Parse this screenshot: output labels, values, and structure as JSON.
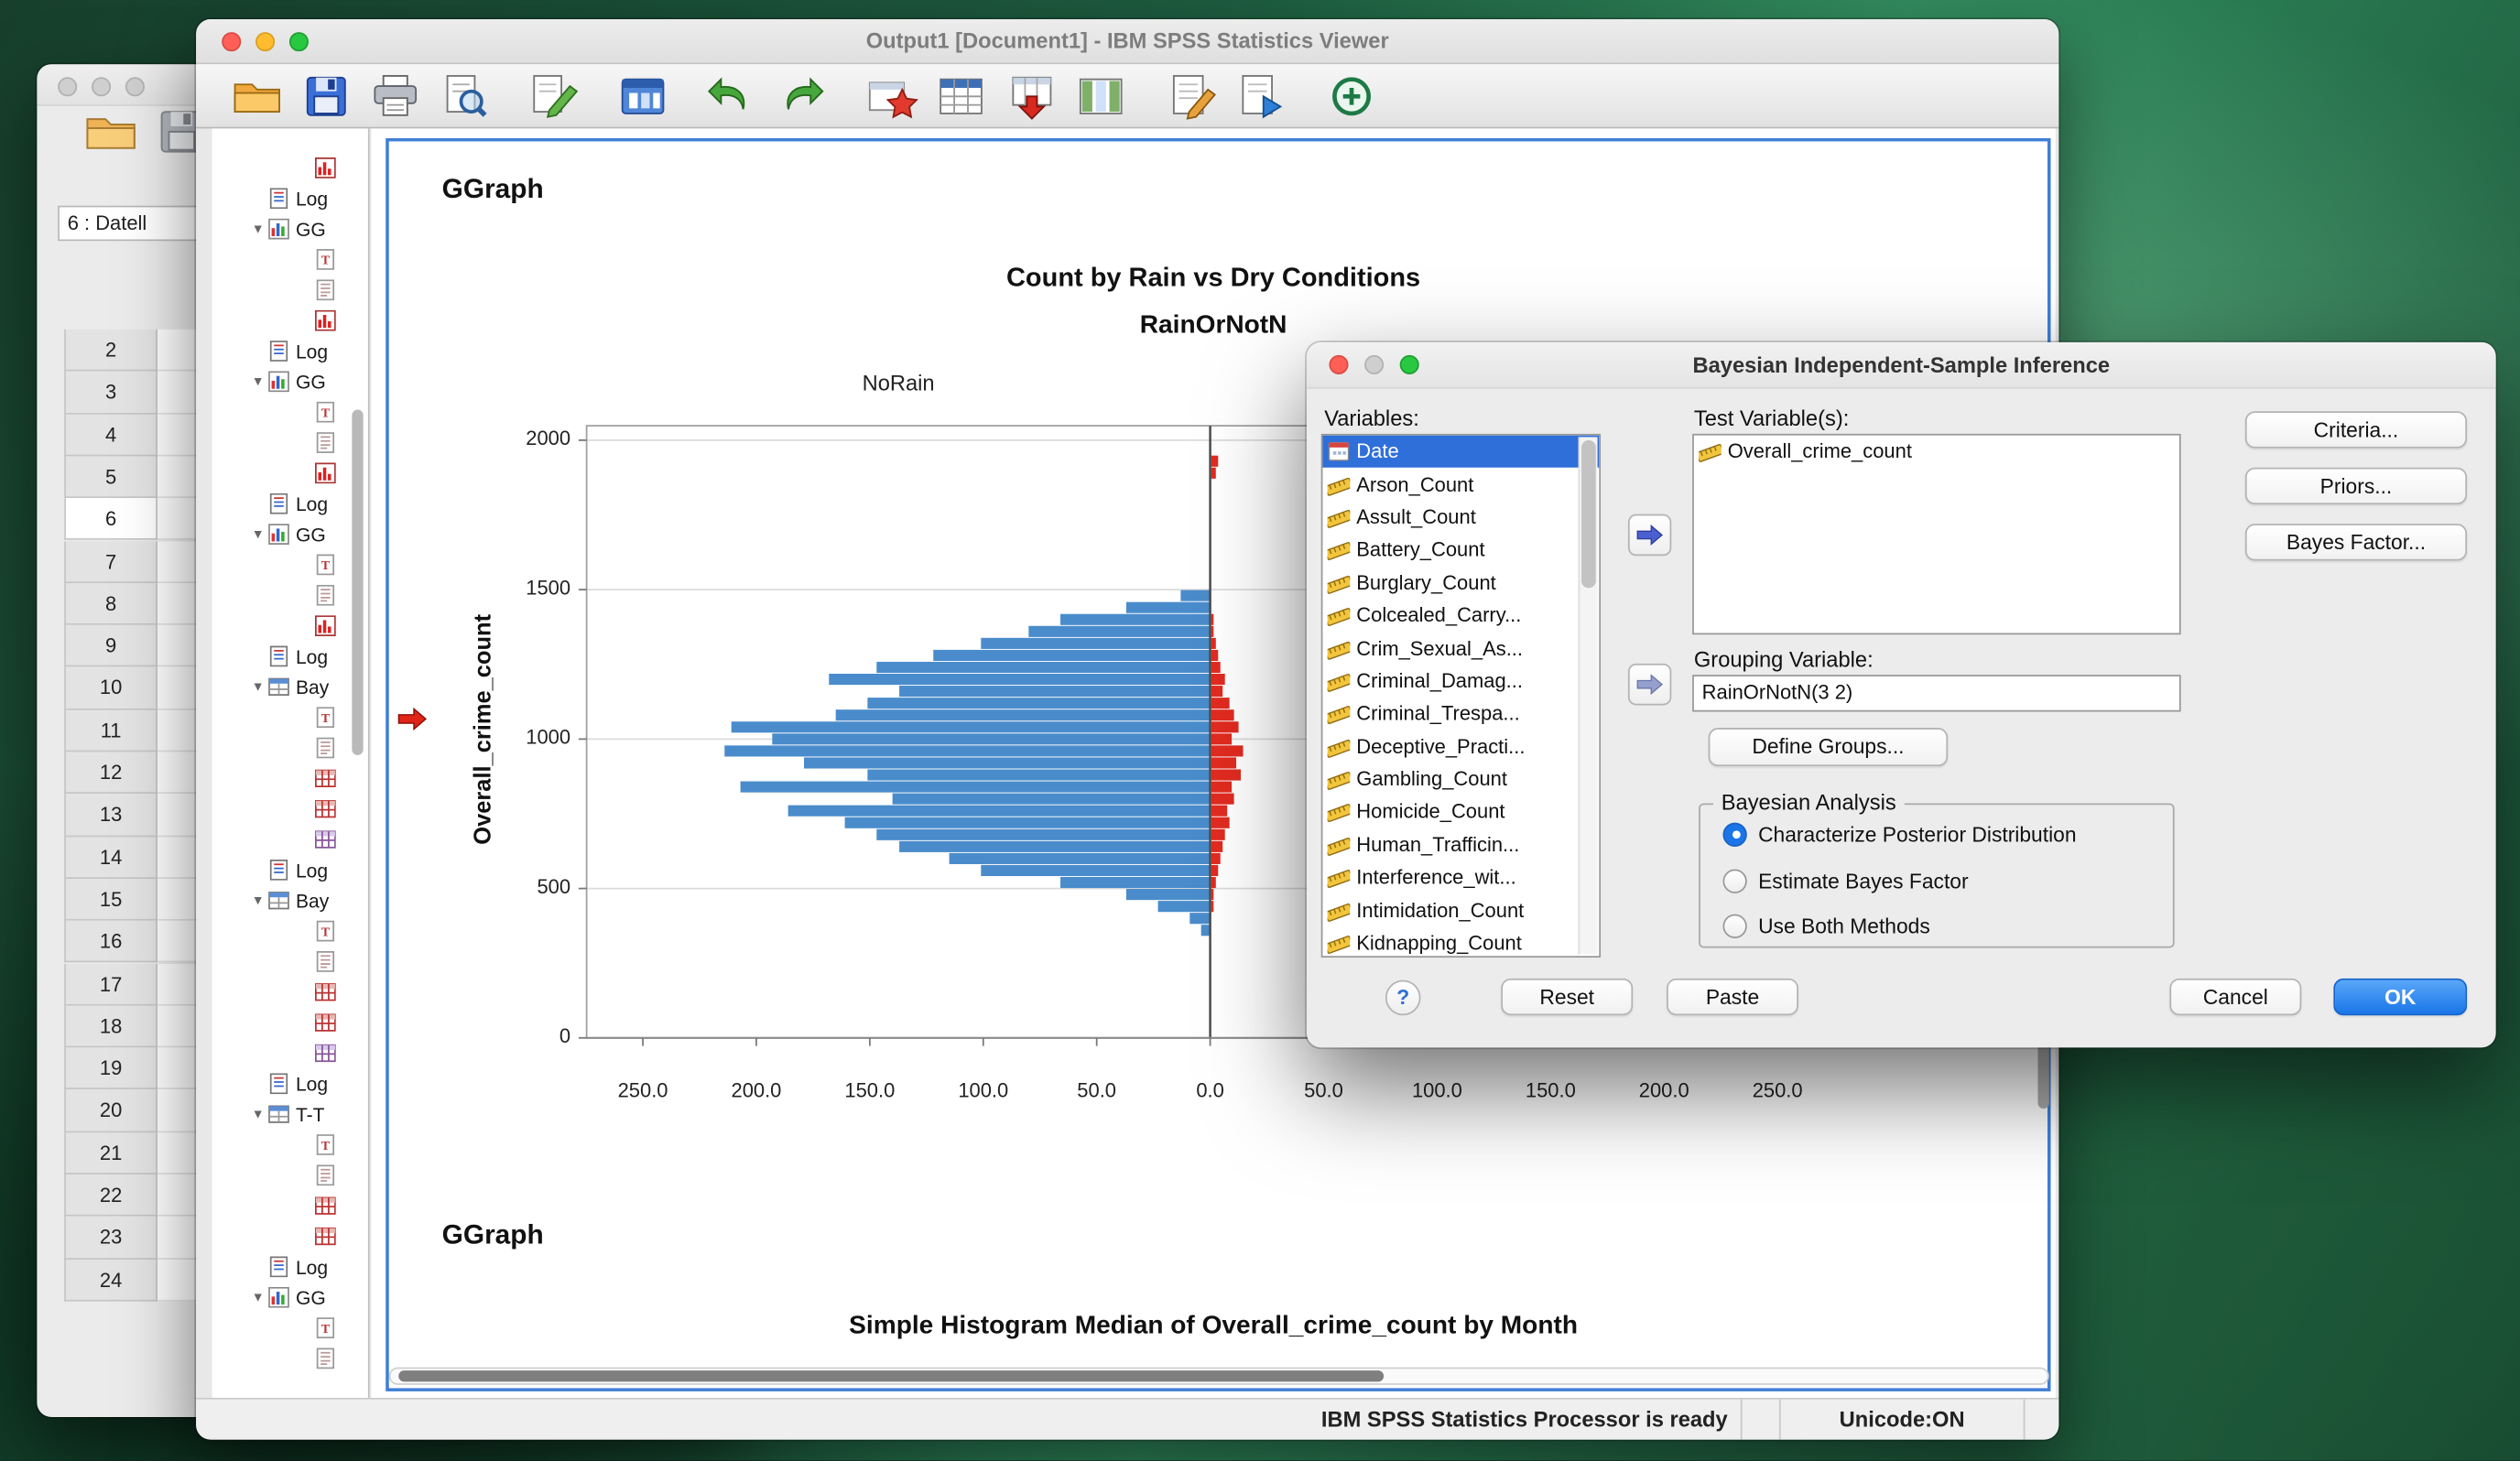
{
  "desktop": {
    "wallpaper_primary": "#2f8a5c"
  },
  "icons": {
    "marker": "red-arrow-icon",
    "transfer_primary": "transfer-arrow-icon",
    "transfer_secondary": "transfer-arrow-secondary-icon"
  },
  "data_editor": {
    "cell_ref": "6 : Datell",
    "row_numbers": [
      "2",
      "3",
      "4",
      "5",
      "6",
      "7",
      "8",
      "9",
      "10",
      "11",
      "12",
      "13",
      "14",
      "15",
      "16",
      "17",
      "18",
      "19",
      "20",
      "21",
      "22",
      "23",
      "24"
    ],
    "selected_row": "6",
    "toolbar_icons": [
      {
        "name": "open-icon"
      },
      {
        "name": "save-gray-icon"
      }
    ]
  },
  "viewer": {
    "title": "Output1 [Document1] - IBM SPSS Statistics Viewer",
    "toolbar_icons": [
      {
        "name": "open-icon"
      },
      {
        "name": "save-icon"
      },
      {
        "name": "print-icon"
      },
      {
        "name": "print-preview-icon"
      },
      {
        "name": "export-icon"
      },
      {
        "name": "recall-dialogs-icon"
      },
      {
        "name": "undo-icon"
      },
      {
        "name": "redo-icon"
      },
      {
        "name": "goto-case-icon"
      },
      {
        "name": "goto-variable-icon"
      },
      {
        "name": "use-variable-sets-icon"
      },
      {
        "name": "show-variables-icon"
      },
      {
        "name": "insert-heading-icon"
      },
      {
        "name": "run-script-icon"
      },
      {
        "name": "designate-window-icon"
      }
    ],
    "outline": [
      {
        "icon": "chart-icon",
        "label": "",
        "depth": 2
      },
      {
        "icon": "log-icon",
        "label": "Log",
        "depth": 1
      },
      {
        "icon": "ggraph-icon",
        "label": "GG",
        "depth": 1,
        "expander": true
      },
      {
        "icon": "title-icon",
        "label": "",
        "depth": 2
      },
      {
        "icon": "notes-icon",
        "label": "",
        "depth": 2
      },
      {
        "icon": "chart-icon",
        "label": "",
        "depth": 2
      },
      {
        "icon": "log-icon",
        "label": "Log",
        "depth": 1
      },
      {
        "icon": "ggraph-icon",
        "label": "GG",
        "depth": 1,
        "expander": true
      },
      {
        "icon": "title-icon",
        "label": "",
        "depth": 2
      },
      {
        "icon": "notes-icon",
        "label": "",
        "depth": 2
      },
      {
        "icon": "chart-icon",
        "label": "",
        "depth": 2
      },
      {
        "icon": "log-icon",
        "label": "Log",
        "depth": 1
      },
      {
        "icon": "ggraph-icon",
        "label": "GG",
        "depth": 1,
        "expander": true
      },
      {
        "icon": "title-icon",
        "label": "",
        "depth": 2
      },
      {
        "icon": "notes-icon",
        "label": "",
        "depth": 2
      },
      {
        "icon": "chart-icon",
        "label": "",
        "depth": 2
      },
      {
        "icon": "log-icon",
        "label": "Log",
        "depth": 1
      },
      {
        "icon": "proc-icon",
        "label": "Bay",
        "depth": 1,
        "expander": true
      },
      {
        "icon": "title-icon",
        "label": "",
        "depth": 2
      },
      {
        "icon": "notes-icon",
        "label": "",
        "depth": 2
      },
      {
        "icon": "table-icon",
        "label": "",
        "depth": 2
      },
      {
        "icon": "table-icon",
        "label": "",
        "depth": 2
      },
      {
        "icon": "tablep-icon",
        "label": "",
        "depth": 2
      },
      {
        "icon": "log-icon",
        "label": "Log",
        "depth": 1
      },
      {
        "icon": "proc-icon",
        "label": "Bay",
        "depth": 1,
        "expander": true
      },
      {
        "icon": "title-icon",
        "label": "",
        "depth": 2
      },
      {
        "icon": "notes-icon",
        "label": "",
        "depth": 2
      },
      {
        "icon": "table-icon",
        "label": "",
        "depth": 2
      },
      {
        "icon": "table-icon",
        "label": "",
        "depth": 2
      },
      {
        "icon": "tablep-icon",
        "label": "",
        "depth": 2
      },
      {
        "icon": "log-icon",
        "label": "Log",
        "depth": 1
      },
      {
        "icon": "proc-icon",
        "label": "T-T",
        "depth": 1,
        "expander": true
      },
      {
        "icon": "title-icon",
        "label": "",
        "depth": 2
      },
      {
        "icon": "notes-icon",
        "label": "",
        "depth": 2
      },
      {
        "icon": "table-icon",
        "label": "",
        "depth": 2
      },
      {
        "icon": "table-icon",
        "label": "",
        "depth": 2
      },
      {
        "icon": "log-icon",
        "label": "Log",
        "depth": 1
      },
      {
        "icon": "ggraph-icon",
        "label": "GG",
        "depth": 1,
        "expander": true
      },
      {
        "icon": "title-icon",
        "label": "",
        "depth": 2
      },
      {
        "icon": "notes-icon",
        "label": "",
        "depth": 2
      }
    ],
    "status": {
      "ready": "IBM SPSS Statistics Processor is ready",
      "unicode": "Unicode:ON"
    }
  },
  "output": {
    "heading1": "GGraph",
    "heading2": "GGraph",
    "subtitle2": "Simple Histogram Median of Overall_crime_count by Month"
  },
  "chart_data": {
    "type": "bar",
    "variant": "population-pyramid-histogram",
    "title": "Count by Rain vs Dry Conditions",
    "subtitle": "RainOrNotN",
    "panel_labels": [
      "NoRain"
    ],
    "ylabel": "Overall_crime_count",
    "ylim": [
      0,
      2000
    ],
    "yticks": [
      "2000",
      "1500",
      "1000",
      "500",
      "0"
    ],
    "xtick_labels": [
      "250.0",
      "200.0",
      "150.0",
      "100.0",
      "50.0",
      "0.0",
      "50.0",
      "100.0",
      "150.0",
      "200.0",
      "250.0"
    ],
    "x_unit_max": 250,
    "bin_width": 40,
    "bins_center": [
      1480,
      1440,
      1400,
      1360,
      1320,
      1280,
      1240,
      1200,
      1160,
      1120,
      1080,
      1040,
      1000,
      960,
      920,
      880,
      840,
      800,
      760,
      720,
      680,
      640,
      600,
      560,
      520,
      480,
      440,
      400,
      360
    ],
    "series": [
      {
        "name": "NoRain",
        "color": "#4A8CCB",
        "values": [
          13,
          37,
          66,
          80,
          101,
          122,
          147,
          168,
          137,
          151,
          165,
          211,
          193,
          214,
          179,
          151,
          207,
          140,
          186,
          161,
          147,
          137,
          115,
          101,
          66,
          37,
          23,
          9,
          4
        ]
      },
      {
        "name": "Rain",
        "color": "#E12B20",
        "values": [
          0,
          0,
          1,
          1,
          2,
          3,
          4,
          6,
          5,
          8,
          10,
          12,
          9,
          14,
          11,
          13,
          9,
          10,
          7,
          8,
          6,
          5,
          4,
          3,
          2,
          1,
          1,
          0,
          0
        ]
      }
    ],
    "outliers": [
      {
        "series": "Rain",
        "bin": 1930,
        "value": 3
      },
      {
        "series": "Rain",
        "bin": 1890,
        "value": 2
      }
    ],
    "colors": {
      "grid": "#dcdcdc",
      "axis": "#8c8c8c",
      "frame": "#a0a0a0"
    },
    "legend_position": "none",
    "grid": true
  },
  "dialog": {
    "title": "Bayesian Independent-Sample Inference",
    "variables_label": "Variables:",
    "variables": [
      {
        "label": "Date",
        "icon": "date-variable-icon",
        "selected": true
      },
      {
        "label": "Arson_Count",
        "icon": "scale-measure-icon"
      },
      {
        "label": "Assult_Count",
        "icon": "scale-measure-icon"
      },
      {
        "label": "Battery_Count",
        "icon": "scale-measure-icon"
      },
      {
        "label": "Burglary_Count",
        "icon": "scale-measure-icon"
      },
      {
        "label": "Colcealed_Carry...",
        "icon": "scale-measure-icon"
      },
      {
        "label": "Crim_Sexual_As...",
        "icon": "scale-measure-icon"
      },
      {
        "label": "Criminal_Damag...",
        "icon": "scale-measure-icon"
      },
      {
        "label": "Criminal_Trespa...",
        "icon": "scale-measure-icon"
      },
      {
        "label": "Deceptive_Practi...",
        "icon": "scale-measure-icon"
      },
      {
        "label": "Gambling_Count",
        "icon": "scale-measure-icon"
      },
      {
        "label": "Homicide_Count",
        "icon": "scale-measure-icon"
      },
      {
        "label": "Human_Trafficin...",
        "icon": "scale-measure-icon"
      },
      {
        "label": "Interference_wit...",
        "icon": "scale-measure-icon"
      },
      {
        "label": "Intimidation_Count",
        "icon": "scale-measure-icon"
      },
      {
        "label": "Kidnapping_Count",
        "icon": "scale-measure-icon"
      }
    ],
    "test_label": "Test Variable(s):",
    "test_variables": [
      {
        "label": "Overall_crime_count",
        "icon": "scale-measure-icon"
      }
    ],
    "grouping_label": "Grouping Variable:",
    "grouping_value": "RainOrNotN(3 2)",
    "define_groups_label": "Define Groups...",
    "group_box_label": "Bayesian Analysis",
    "radio_options": [
      {
        "label": "Characterize Posterior Distribution",
        "selected": true
      },
      {
        "label": "Estimate Bayes Factor",
        "selected": false
      },
      {
        "label": "Use Both Methods",
        "selected": false
      }
    ],
    "side_buttons": [
      "Criteria...",
      "Priors...",
      "Bayes Factor..."
    ],
    "help_label": "?",
    "reset_label": "Reset",
    "paste_label": "Paste",
    "cancel_label": "Cancel",
    "ok_label": "OK"
  }
}
